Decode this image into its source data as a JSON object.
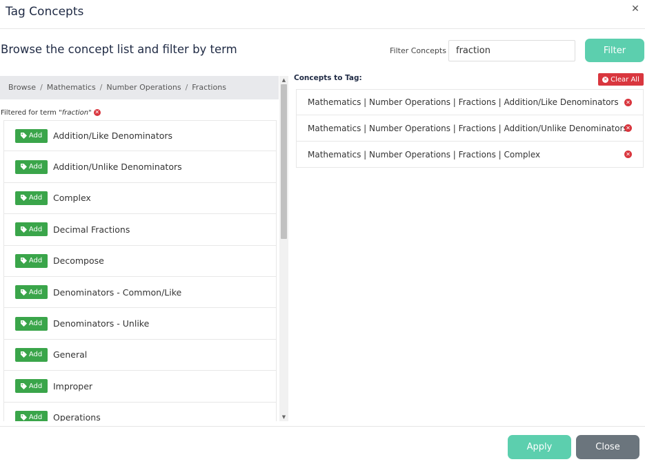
{
  "dialog": {
    "title": "Tag Concepts",
    "close_icon": "close-icon"
  },
  "browse": {
    "heading": "Browse the concept list and filter by term"
  },
  "filter": {
    "label": "Filter Concepts",
    "value": "fraction",
    "button_label": "Filter"
  },
  "breadcrumb": [
    "Browse",
    "Mathematics",
    "Number Operations",
    "Fractions"
  ],
  "filtered_note": {
    "prefix": "Filtered for term",
    "term": "\"fraction\"",
    "clear_icon": "remove-circle-icon"
  },
  "concepts": {
    "add_label": "Add",
    "add_icon": "tag-icon",
    "items": [
      "Addition/Like Denominators",
      "Addition/Unlike Denominators",
      "Complex",
      "Decimal Fractions",
      "Decompose",
      "Denominators - Common/Like",
      "Denominators - Unlike",
      "General",
      "Improper",
      "Operations"
    ]
  },
  "tagged": {
    "title": "Concepts to Tag:",
    "clear_all_label": "Clear All",
    "items": [
      "Mathematics | Number Operations | Fractions | Addition/Like Denominators",
      "Mathematics | Number Operations | Fractions | Addition/Unlike Denominators",
      "Mathematics | Number Operations | Fractions | Complex"
    ]
  },
  "footer": {
    "apply_label": "Apply",
    "close_label": "Close"
  },
  "colors": {
    "primary_teal": "#5ccfae",
    "add_green": "#3aa54a",
    "danger_red": "#d9363e",
    "secondary_gray": "#6b757d"
  }
}
